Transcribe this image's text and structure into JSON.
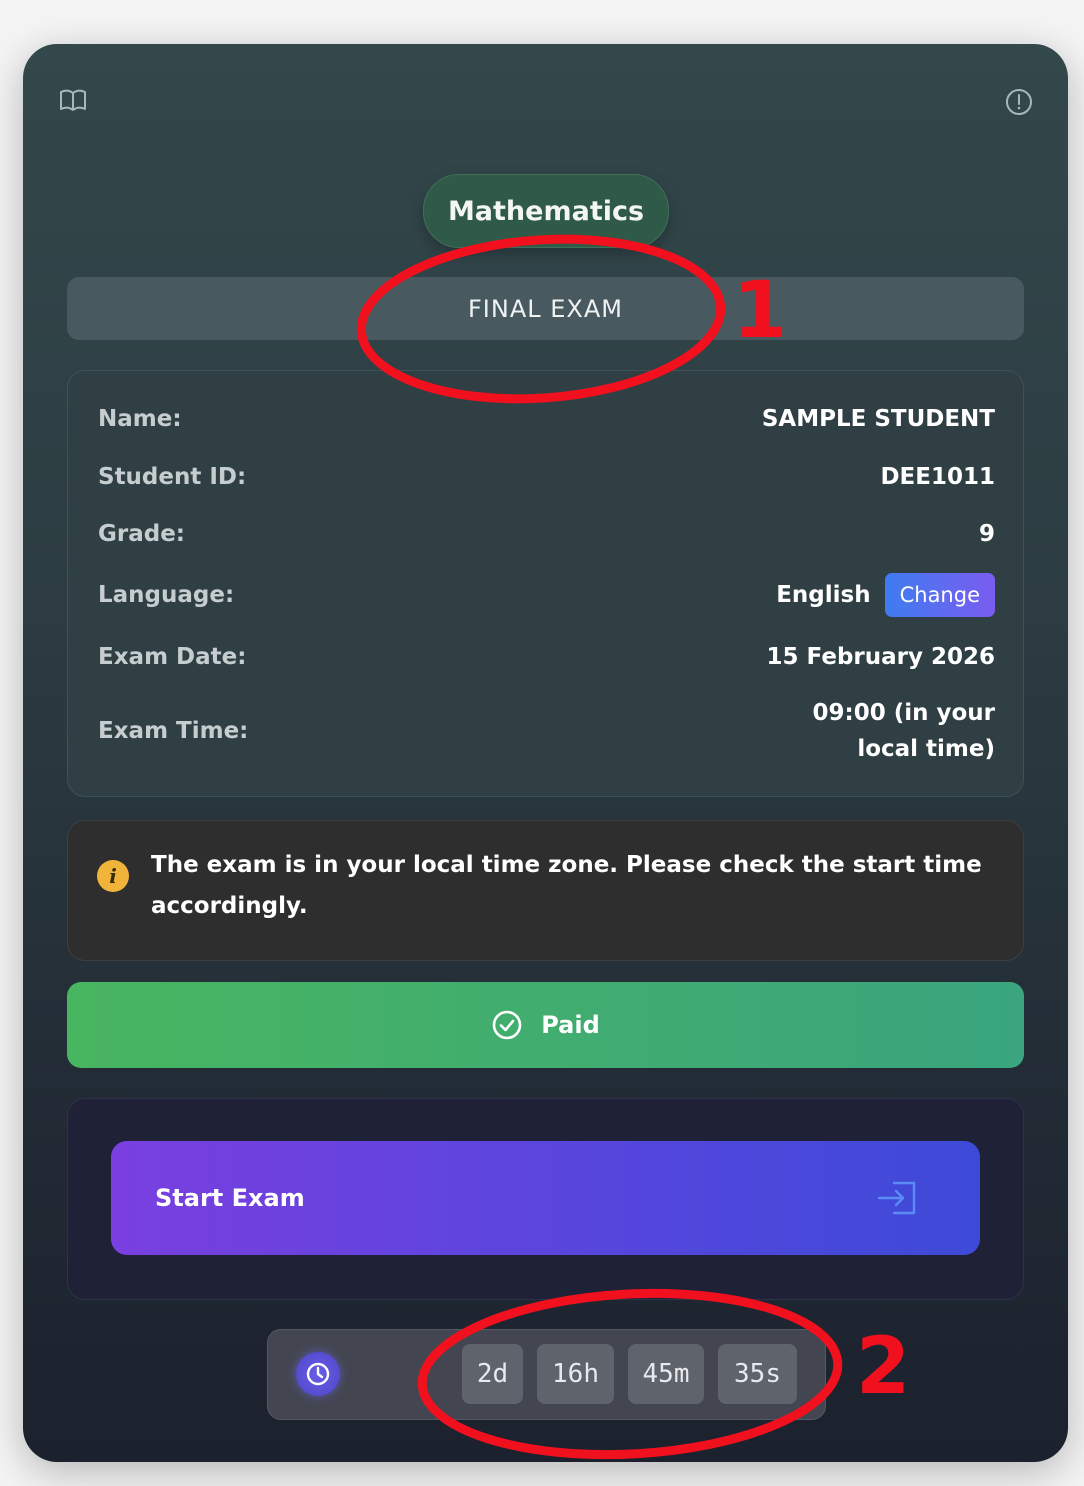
{
  "header": {
    "subject": "Mathematics",
    "exam_type": "FINAL EXAM"
  },
  "student": {
    "name_label": "Name:",
    "name_value": "SAMPLE STUDENT",
    "id_label": "Student ID:",
    "id_value": "DEE1011",
    "grade_label": "Grade:",
    "grade_value": "9",
    "language_label": "Language:",
    "language_value": "English",
    "change_label": "Change",
    "date_label": "Exam Date:",
    "date_value": "15 February 2026",
    "time_label": "Exam Time:",
    "time_value_line1": "09:00 (in your",
    "time_value_line2": "local time)"
  },
  "notice": {
    "text": "The exam is in your local time zone. Please check the start time accordingly.",
    "icon": "info-icon"
  },
  "payment": {
    "status_label": "Paid",
    "icon": "check-circle-icon"
  },
  "start": {
    "label": "Start Exam",
    "icon": "enter-icon"
  },
  "countdown": {
    "days": "2d",
    "hours": "16h",
    "minutes": "45m",
    "seconds": "35s",
    "icon": "clock-icon"
  },
  "annotations": {
    "label_1": "1",
    "label_2": "2",
    "color": "#f0101e"
  },
  "colors": {
    "accent_green": "#48b560",
    "accent_purple": "#7a3fe0",
    "accent_blue": "#3d4ad8",
    "warning": "#f0b43a"
  }
}
